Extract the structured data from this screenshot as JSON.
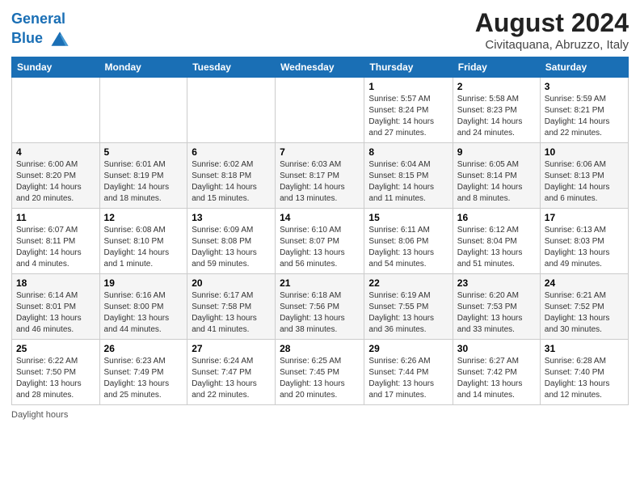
{
  "logo": {
    "line1": "General",
    "line2": "Blue"
  },
  "header": {
    "title": "August 2024",
    "subtitle": "Civitaquana, Abruzzo, Italy"
  },
  "weekdays": [
    "Sunday",
    "Monday",
    "Tuesday",
    "Wednesday",
    "Thursday",
    "Friday",
    "Saturday"
  ],
  "weeks": [
    [
      {
        "day": "",
        "info": ""
      },
      {
        "day": "",
        "info": ""
      },
      {
        "day": "",
        "info": ""
      },
      {
        "day": "",
        "info": ""
      },
      {
        "day": "1",
        "info": "Sunrise: 5:57 AM\nSunset: 8:24 PM\nDaylight: 14 hours and 27 minutes."
      },
      {
        "day": "2",
        "info": "Sunrise: 5:58 AM\nSunset: 8:23 PM\nDaylight: 14 hours and 24 minutes."
      },
      {
        "day": "3",
        "info": "Sunrise: 5:59 AM\nSunset: 8:21 PM\nDaylight: 14 hours and 22 minutes."
      }
    ],
    [
      {
        "day": "4",
        "info": "Sunrise: 6:00 AM\nSunset: 8:20 PM\nDaylight: 14 hours and 20 minutes."
      },
      {
        "day": "5",
        "info": "Sunrise: 6:01 AM\nSunset: 8:19 PM\nDaylight: 14 hours and 18 minutes."
      },
      {
        "day": "6",
        "info": "Sunrise: 6:02 AM\nSunset: 8:18 PM\nDaylight: 14 hours and 15 minutes."
      },
      {
        "day": "7",
        "info": "Sunrise: 6:03 AM\nSunset: 8:17 PM\nDaylight: 14 hours and 13 minutes."
      },
      {
        "day": "8",
        "info": "Sunrise: 6:04 AM\nSunset: 8:15 PM\nDaylight: 14 hours and 11 minutes."
      },
      {
        "day": "9",
        "info": "Sunrise: 6:05 AM\nSunset: 8:14 PM\nDaylight: 14 hours and 8 minutes."
      },
      {
        "day": "10",
        "info": "Sunrise: 6:06 AM\nSunset: 8:13 PM\nDaylight: 14 hours and 6 minutes."
      }
    ],
    [
      {
        "day": "11",
        "info": "Sunrise: 6:07 AM\nSunset: 8:11 PM\nDaylight: 14 hours and 4 minutes."
      },
      {
        "day": "12",
        "info": "Sunrise: 6:08 AM\nSunset: 8:10 PM\nDaylight: 14 hours and 1 minute."
      },
      {
        "day": "13",
        "info": "Sunrise: 6:09 AM\nSunset: 8:08 PM\nDaylight: 13 hours and 59 minutes."
      },
      {
        "day": "14",
        "info": "Sunrise: 6:10 AM\nSunset: 8:07 PM\nDaylight: 13 hours and 56 minutes."
      },
      {
        "day": "15",
        "info": "Sunrise: 6:11 AM\nSunset: 8:06 PM\nDaylight: 13 hours and 54 minutes."
      },
      {
        "day": "16",
        "info": "Sunrise: 6:12 AM\nSunset: 8:04 PM\nDaylight: 13 hours and 51 minutes."
      },
      {
        "day": "17",
        "info": "Sunrise: 6:13 AM\nSunset: 8:03 PM\nDaylight: 13 hours and 49 minutes."
      }
    ],
    [
      {
        "day": "18",
        "info": "Sunrise: 6:14 AM\nSunset: 8:01 PM\nDaylight: 13 hours and 46 minutes."
      },
      {
        "day": "19",
        "info": "Sunrise: 6:16 AM\nSunset: 8:00 PM\nDaylight: 13 hours and 44 minutes."
      },
      {
        "day": "20",
        "info": "Sunrise: 6:17 AM\nSunset: 7:58 PM\nDaylight: 13 hours and 41 minutes."
      },
      {
        "day": "21",
        "info": "Sunrise: 6:18 AM\nSunset: 7:56 PM\nDaylight: 13 hours and 38 minutes."
      },
      {
        "day": "22",
        "info": "Sunrise: 6:19 AM\nSunset: 7:55 PM\nDaylight: 13 hours and 36 minutes."
      },
      {
        "day": "23",
        "info": "Sunrise: 6:20 AM\nSunset: 7:53 PM\nDaylight: 13 hours and 33 minutes."
      },
      {
        "day": "24",
        "info": "Sunrise: 6:21 AM\nSunset: 7:52 PM\nDaylight: 13 hours and 30 minutes."
      }
    ],
    [
      {
        "day": "25",
        "info": "Sunrise: 6:22 AM\nSunset: 7:50 PM\nDaylight: 13 hours and 28 minutes."
      },
      {
        "day": "26",
        "info": "Sunrise: 6:23 AM\nSunset: 7:49 PM\nDaylight: 13 hours and 25 minutes."
      },
      {
        "day": "27",
        "info": "Sunrise: 6:24 AM\nSunset: 7:47 PM\nDaylight: 13 hours and 22 minutes."
      },
      {
        "day": "28",
        "info": "Sunrise: 6:25 AM\nSunset: 7:45 PM\nDaylight: 13 hours and 20 minutes."
      },
      {
        "day": "29",
        "info": "Sunrise: 6:26 AM\nSunset: 7:44 PM\nDaylight: 13 hours and 17 minutes."
      },
      {
        "day": "30",
        "info": "Sunrise: 6:27 AM\nSunset: 7:42 PM\nDaylight: 13 hours and 14 minutes."
      },
      {
        "day": "31",
        "info": "Sunrise: 6:28 AM\nSunset: 7:40 PM\nDaylight: 13 hours and 12 minutes."
      }
    ]
  ],
  "footer": {
    "note": "Daylight hours"
  },
  "colors": {
    "header_bg": "#1a6fb5",
    "accent": "#1a6fb5"
  }
}
